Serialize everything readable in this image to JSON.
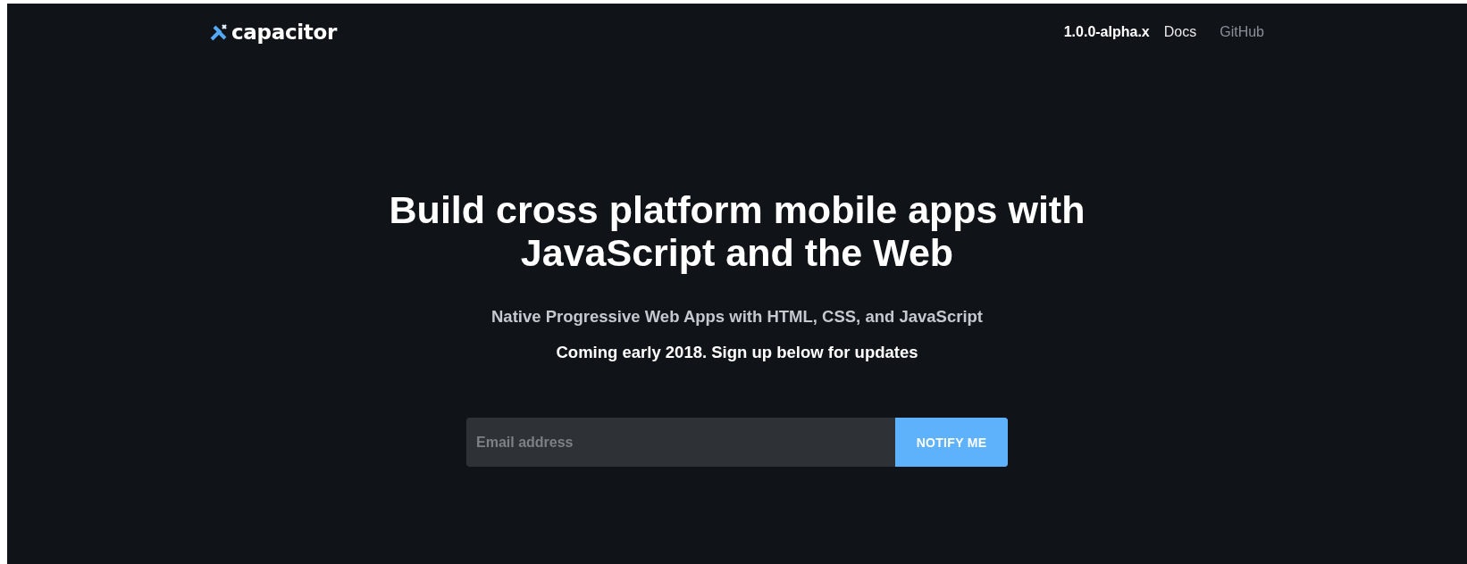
{
  "header": {
    "logo": "capacitor",
    "nav": [
      {
        "label": "1.0.0-alpha.x",
        "kind": "version"
      },
      {
        "label": "Docs",
        "kind": "link"
      },
      {
        "label": "GitHub",
        "kind": "muted"
      }
    ]
  },
  "hero": {
    "title": "Build cross platform mobile apps with JavaScript and the Web",
    "subtitle": "Native Progressive Web Apps with HTML, CSS, and JavaScript",
    "note": "Coming early 2018. Sign up below for updates"
  },
  "signup": {
    "placeholder": "Email address",
    "button": "NOTIFY ME"
  }
}
